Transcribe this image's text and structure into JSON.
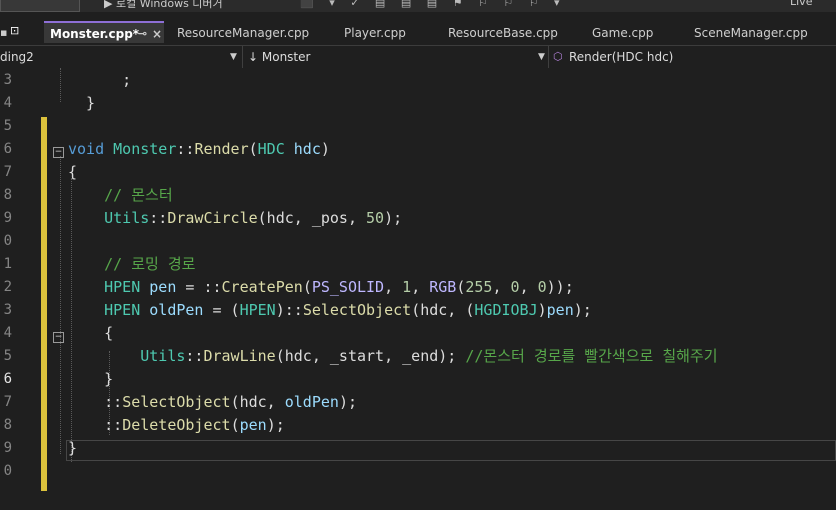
{
  "toolbar": {
    "run_label": "▶ 로컬 Windows 디버거",
    "live_label": "Live"
  },
  "tabs": [
    {
      "label": "Monster.cpp*",
      "active": true
    },
    {
      "label": "ResourceManager.cpp"
    },
    {
      "label": "Player.cpp"
    },
    {
      "label": "ResourceBase.cpp"
    },
    {
      "label": "Game.cpp"
    },
    {
      "label": "SceneManager.cpp"
    }
  ],
  "nav": {
    "project": "ding2",
    "scope": "↓ Monster",
    "member": "Render(HDC hdc)"
  },
  "editor": {
    "line_numbers": [
      "3",
      "4",
      "5",
      "6",
      "7",
      "8",
      "9",
      "0",
      "1",
      "2",
      "3",
      "4",
      "5",
      "6",
      "7",
      "8",
      "9",
      "0"
    ],
    "lines": [
      [
        {
          "t": "      ;",
          "c": "plain"
        }
      ],
      [
        {
          "t": "  }",
          "c": "plain"
        }
      ],
      [],
      [
        {
          "t": "void",
          "c": "kw"
        },
        {
          "t": " ",
          "c": "plain"
        },
        {
          "t": "Monster",
          "c": "type"
        },
        {
          "t": "::",
          "c": "plain"
        },
        {
          "t": "Render",
          "c": "fn"
        },
        {
          "t": "(",
          "c": "plain"
        },
        {
          "t": "HDC",
          "c": "type"
        },
        {
          "t": " ",
          "c": "plain"
        },
        {
          "t": "hdc",
          "c": "var"
        },
        {
          "t": ")",
          "c": "plain"
        }
      ],
      [
        {
          "t": "{",
          "c": "plain"
        }
      ],
      [
        {
          "t": "    ",
          "c": "plain"
        },
        {
          "t": "// 몬스터",
          "c": "cm"
        }
      ],
      [
        {
          "t": "    ",
          "c": "plain"
        },
        {
          "t": "Utils",
          "c": "type"
        },
        {
          "t": "::",
          "c": "plain"
        },
        {
          "t": "DrawCircle",
          "c": "fn"
        },
        {
          "t": "(hdc, _pos, ",
          "c": "plain"
        },
        {
          "t": "50",
          "c": "num"
        },
        {
          "t": ");",
          "c": "plain"
        }
      ],
      [],
      [
        {
          "t": "    ",
          "c": "plain"
        },
        {
          "t": "// 로밍 경로",
          "c": "cm"
        }
      ],
      [
        {
          "t": "    ",
          "c": "plain"
        },
        {
          "t": "HPEN",
          "c": "type"
        },
        {
          "t": " ",
          "c": "plain"
        },
        {
          "t": "pen",
          "c": "var"
        },
        {
          "t": " = ::",
          "c": "plain"
        },
        {
          "t": "CreatePen",
          "c": "fn"
        },
        {
          "t": "(",
          "c": "plain"
        },
        {
          "t": "PS_SOLID",
          "c": "mac"
        },
        {
          "t": ", ",
          "c": "plain"
        },
        {
          "t": "1",
          "c": "num"
        },
        {
          "t": ", ",
          "c": "plain"
        },
        {
          "t": "RGB",
          "c": "mac"
        },
        {
          "t": "(",
          "c": "plain"
        },
        {
          "t": "255",
          "c": "num"
        },
        {
          "t": ", ",
          "c": "plain"
        },
        {
          "t": "0",
          "c": "num"
        },
        {
          "t": ", ",
          "c": "plain"
        },
        {
          "t": "0",
          "c": "num"
        },
        {
          "t": "));",
          "c": "plain"
        }
      ],
      [
        {
          "t": "    ",
          "c": "plain"
        },
        {
          "t": "HPEN",
          "c": "type"
        },
        {
          "t": " ",
          "c": "plain"
        },
        {
          "t": "oldPen",
          "c": "var"
        },
        {
          "t": " = (",
          "c": "plain"
        },
        {
          "t": "HPEN",
          "c": "type"
        },
        {
          "t": ")::",
          "c": "plain"
        },
        {
          "t": "SelectObject",
          "c": "fn"
        },
        {
          "t": "(hdc, (",
          "c": "plain"
        },
        {
          "t": "HGDIOBJ",
          "c": "type"
        },
        {
          "t": ")",
          "c": "plain"
        },
        {
          "t": "pen",
          "c": "var"
        },
        {
          "t": ");",
          "c": "plain"
        }
      ],
      [
        {
          "t": "    {",
          "c": "plain"
        }
      ],
      [
        {
          "t": "        ",
          "c": "plain"
        },
        {
          "t": "Utils",
          "c": "type"
        },
        {
          "t": "::",
          "c": "plain"
        },
        {
          "t": "DrawLine",
          "c": "fn"
        },
        {
          "t": "(hdc, _start, _end); ",
          "c": "plain"
        },
        {
          "t": "//몬스터 경로를 빨간색으로 칠해주기",
          "c": "cm"
        }
      ],
      [
        {
          "t": "    }",
          "c": "plain"
        }
      ],
      [
        {
          "t": "    ::",
          "c": "plain"
        },
        {
          "t": "SelectObject",
          "c": "fn"
        },
        {
          "t": "(hdc, ",
          "c": "plain"
        },
        {
          "t": "oldPen",
          "c": "var"
        },
        {
          "t": ");",
          "c": "plain"
        }
      ],
      [
        {
          "t": "    ::",
          "c": "plain"
        },
        {
          "t": "DeleteObject",
          "c": "fn"
        },
        {
          "t": "(",
          "c": "plain"
        },
        {
          "t": "pen",
          "c": "var"
        },
        {
          "t": ");",
          "c": "plain"
        }
      ],
      [
        {
          "t": "}",
          "c": "plain"
        }
      ],
      []
    ]
  }
}
